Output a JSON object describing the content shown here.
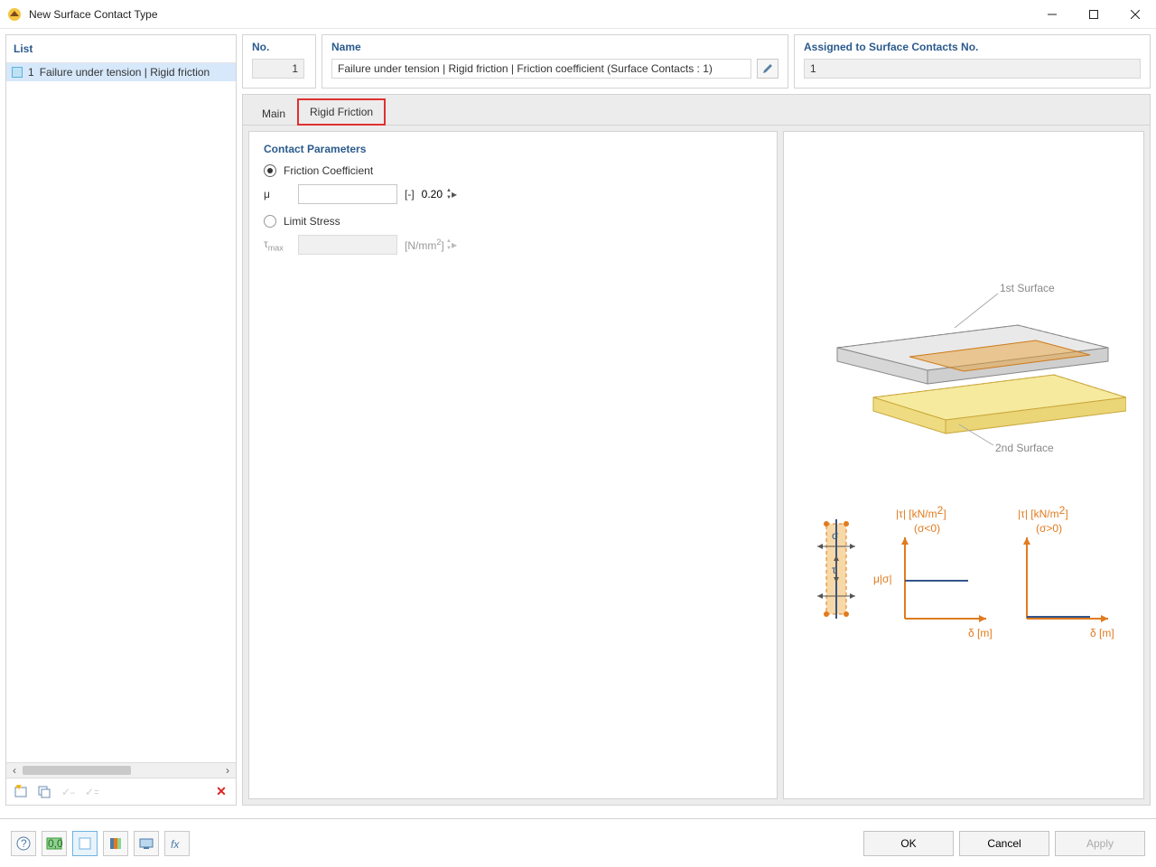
{
  "window": {
    "title": "New Surface Contact Type"
  },
  "sidebar": {
    "header": "List",
    "items": [
      {
        "num": "1",
        "label": "Failure under tension | Rigid friction"
      }
    ]
  },
  "header": {
    "no_title": "No.",
    "no_value": "1",
    "name_title": "Name",
    "name_value": "Failure under tension | Rigid friction | Friction coefficient (Surface Contacts : 1)",
    "assigned_title": "Assigned to Surface Contacts No.",
    "assigned_value": "1"
  },
  "tabs": {
    "main": "Main",
    "rigid": "Rigid Friction"
  },
  "params": {
    "section": "Contact Parameters",
    "friction_label": "Friction Coefficient",
    "mu_symbol": "μ",
    "mu_value": "0.20",
    "mu_unit": "[-]",
    "limit_label": "Limit Stress",
    "tmax_symbol": "τmax",
    "tmax_value": "",
    "tmax_unit_html": "[N/mm²]"
  },
  "diagram": {
    "first_surface": "1st Surface",
    "second_surface": "2nd Surface",
    "tau_axis": "|τ| [kN/m²]",
    "sigma_neg": "(σ<0)",
    "sigma_pos": "(σ>0)",
    "mu_sigma": "μ|σ|",
    "delta_axis": "δ [m]",
    "sigma": "σ",
    "tau": "τ"
  },
  "buttons": {
    "ok": "OK",
    "cancel": "Cancel",
    "apply": "Apply"
  }
}
